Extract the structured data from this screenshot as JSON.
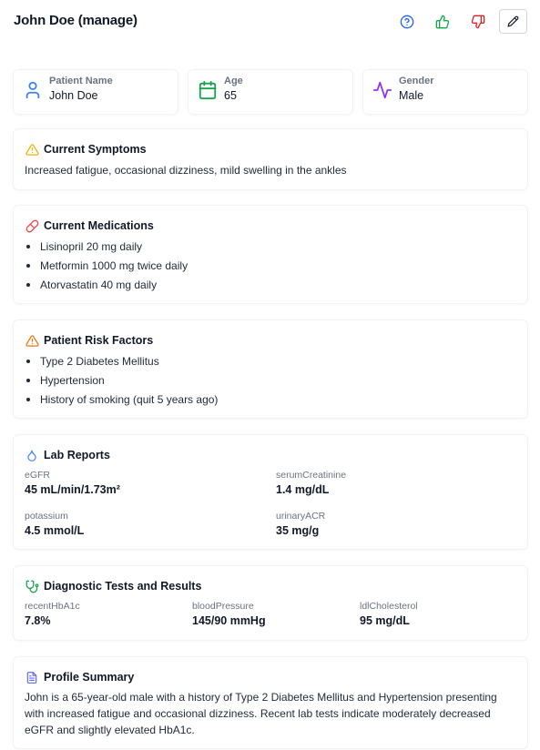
{
  "header": {
    "title": "John Doe (manage)",
    "icons": {
      "help": "help-circle-icon",
      "like": "thumbs-up-icon",
      "dislike": "thumbs-down-icon",
      "edit": "pencil-icon"
    },
    "colors": {
      "help": "#2563eb",
      "like": "#16a34a",
      "dislike": "#dc2626"
    }
  },
  "patient": {
    "name": {
      "label": "Patient Name",
      "value": "John Doe",
      "icon": "user-icon",
      "color": "#3b82f6"
    },
    "age": {
      "label": "Age",
      "value": "65",
      "icon": "calendar-icon",
      "color": "#16a34a"
    },
    "gender": {
      "label": "Gender",
      "value": "Male",
      "icon": "activity-icon",
      "color": "#9333ea"
    }
  },
  "symptoms": {
    "title": "Current Symptoms",
    "icon": "warning-triangle-icon",
    "color": "#eab308",
    "text": "Increased fatigue, occasional dizziness, mild swelling in the ankles"
  },
  "medications": {
    "title": "Current Medications",
    "icon": "pill-icon",
    "color": "#ef4444",
    "items": [
      "Lisinopril 20 mg daily",
      "Metformin 1000 mg twice daily",
      "Atorvastatin 40 mg daily"
    ]
  },
  "risk_factors": {
    "title": "Patient Risk Factors",
    "icon": "warning-triangle-icon",
    "color": "#f97316",
    "items": [
      "Type 2 Diabetes Mellitus",
      "Hypertension",
      "History of smoking (quit 5 years ago)"
    ]
  },
  "labs": {
    "title": "Lab Reports",
    "icon": "droplet-icon",
    "color": "#3b82f6",
    "items": [
      {
        "key": "eGFR",
        "value": "45 mL/min/1.73m²"
      },
      {
        "key": "serumCreatinine",
        "value": "1.4 mg/dL"
      },
      {
        "key": "potassium",
        "value": "4.5 mmol/L"
      },
      {
        "key": "urinaryACR",
        "value": "35 mg/g"
      }
    ]
  },
  "diagnostics": {
    "title": "Diagnostic Tests and Results",
    "icon": "stethoscope-icon",
    "color": "#16a34a",
    "items": [
      {
        "key": "recentHbA1c",
        "value": "7.8%"
      },
      {
        "key": "bloodPressure",
        "value": "145/90 mmHg"
      },
      {
        "key": "ldlCholesterol",
        "value": "95 mg/dL"
      }
    ]
  },
  "summary": {
    "title": "Profile Summary",
    "icon": "document-icon",
    "color": "#6366f1",
    "text": "John is a 65-year-old male with a history of Type 2 Diabetes Mellitus and Hypertension presenting with increased fatigue and occasional dizziness. Recent lab tests indicate moderately decreased eGFR and slightly elevated HbA1c."
  }
}
